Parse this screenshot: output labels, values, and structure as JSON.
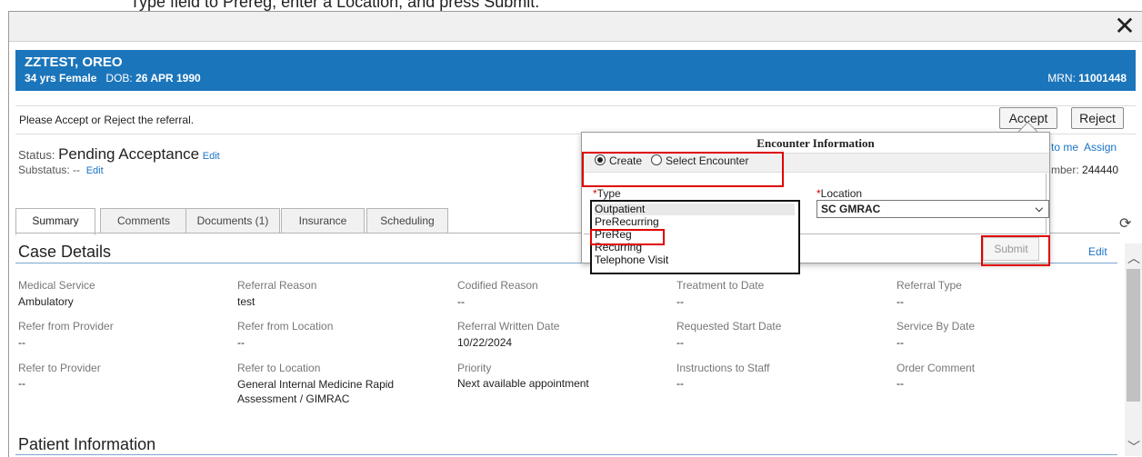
{
  "top_text": "Type field to Prereg, enter a Location, and press Submit.",
  "banner": {
    "name": "ZZTEST, OREO",
    "age_sex": "34 yrs  Female",
    "dob_label": "DOB:",
    "dob": "26 APR 1990",
    "mrn_label": "MRN:",
    "mrn": "11001448"
  },
  "instruction": "Please Accept or Reject the referral.",
  "buttons": {
    "accept": "Accept",
    "reject": "Reject",
    "submit": "Submit"
  },
  "status": {
    "label": "Status:",
    "value": "Pending Acceptance",
    "edit": "Edit",
    "sub_label": "Substatus:",
    "sub_value": "--",
    "sub_edit": "Edit"
  },
  "assign": {
    "to_me": "to me",
    "assign": "Assign",
    "number_label": "mber:",
    "number": "244440"
  },
  "tabs": [
    "Summary",
    "Comments",
    "Documents (1)",
    "Insurance",
    "Scheduling"
  ],
  "case_details": {
    "title": "Case Details",
    "edit": "Edit",
    "fields": [
      {
        "label": "Medical Service",
        "value": "Ambulatory"
      },
      {
        "label": "Referral Reason",
        "value": "test"
      },
      {
        "label": "Codified Reason",
        "value": "--"
      },
      {
        "label": "Treatment to Date",
        "value": "--"
      },
      {
        "label": "Referral Type",
        "value": "--"
      },
      {
        "label": "Refer from Provider",
        "value": "--"
      },
      {
        "label": "Refer from Location",
        "value": "--"
      },
      {
        "label": "Referral Written Date",
        "value": "10/22/2024"
      },
      {
        "label": "Requested Start Date",
        "value": "--"
      },
      {
        "label": "Service By Date",
        "value": "--"
      },
      {
        "label": "Refer to Provider",
        "value": "--"
      },
      {
        "label": "Refer to Location",
        "value": "General Internal Medicine Rapid Assessment / GIMRAC"
      },
      {
        "label": "Priority",
        "value": "Next available appointment"
      },
      {
        "label": "Instructions to Staff",
        "value": "--"
      },
      {
        "label": "Order Comment",
        "value": "--"
      }
    ]
  },
  "patient_info": {
    "title": "Patient Information"
  },
  "encounter": {
    "title": "Encounter Information",
    "radio_create": "Create",
    "radio_select": "Select Encounter",
    "type_label": "Type",
    "location_label": "Location",
    "location_value": "SC GMRAC",
    "type_options": [
      "Outpatient",
      "PreRecurring",
      "PreReg",
      "Recurring",
      "Telephone Visit"
    ],
    "type_selected": "Outpatient"
  },
  "colors": {
    "banner": "#1b75bb",
    "link": "#1a73c8",
    "highlight": "#e00000"
  }
}
